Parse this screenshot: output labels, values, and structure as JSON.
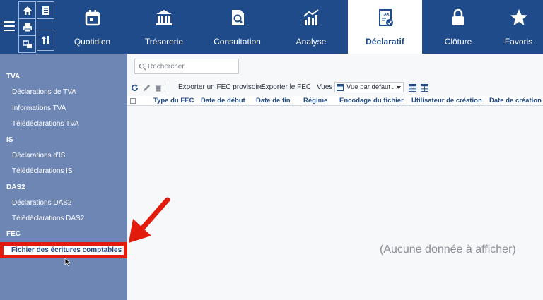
{
  "nav": {
    "items": [
      {
        "label": "Quotidien",
        "icon": "calendar-icon"
      },
      {
        "label": "Trésorerie",
        "icon": "bank-icon"
      },
      {
        "label": "Consultation",
        "icon": "document-search-icon"
      },
      {
        "label": "Analyse",
        "icon": "chart-icon"
      },
      {
        "label": "Déclaratif",
        "icon": "tax-document-icon",
        "active": true
      },
      {
        "label": "Clôture",
        "icon": "lock-icon"
      },
      {
        "label": "Favoris",
        "icon": "star-icon"
      }
    ]
  },
  "sidebar": {
    "sections": [
      {
        "title": "TVA",
        "items": [
          "Déclarations de TVA",
          "Informations TVA",
          "Télédéclarations TVA"
        ]
      },
      {
        "title": "IS",
        "items": [
          "Déclarations d'IS",
          "Télédéclarations IS"
        ]
      },
      {
        "title": "DAS2",
        "items": [
          "Déclarations DAS2",
          "Télédéclarations DAS2"
        ]
      },
      {
        "title": "FEC",
        "items": [
          "Fichier des écritures comptables"
        ]
      }
    ]
  },
  "search": {
    "placeholder": "Rechercher"
  },
  "toolbar": {
    "export_provisional": "Exporter un FEC provisoire",
    "export_fec": "Exporter le FEC",
    "views_label": "Vues",
    "views_selected": "Vue par défaut ..."
  },
  "grid": {
    "columns": [
      "Type du FEC",
      "Date de début",
      "Date de fin",
      "Régime",
      "Encodage du fichier",
      "Utilisateur de création",
      "Date de création"
    ],
    "empty_message": "(Aucune donnée à afficher)"
  },
  "colors": {
    "primary": "#1f4b8a",
    "sidebar": "#6d86b4",
    "highlight": "#e31b0c"
  }
}
